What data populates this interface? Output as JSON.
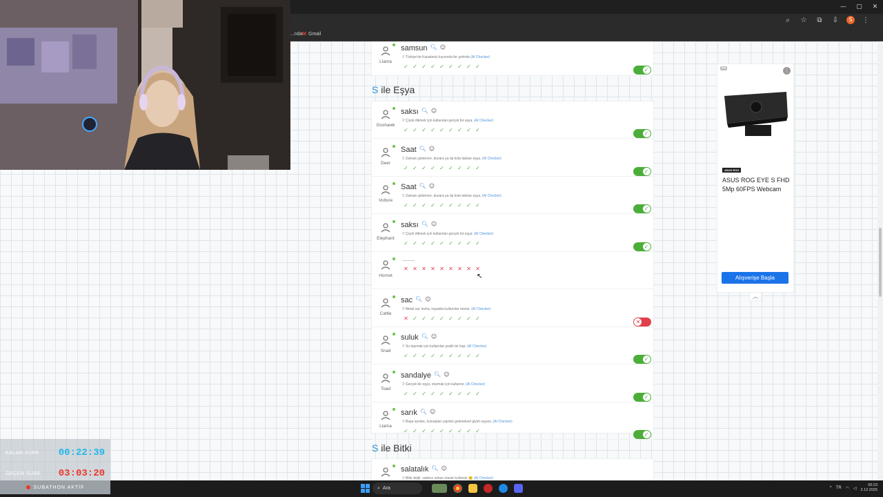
{
  "browser": {
    "bookmarks": [
      {
        "label": "...nda"
      },
      {
        "label": "Gmail"
      }
    ],
    "win_controls": [
      "—",
      "▢",
      "✕"
    ],
    "toolbar_icons": [
      "⌕",
      "☆",
      "⧉",
      "⇩"
    ],
    "profile_initial": "S"
  },
  "top_entry": {
    "word": "samsun",
    "desc": "Türkiye'de Karadeniz kıyısında bir şehirde",
    "ai": "(AI Checker)",
    "player": "Llama",
    "checks": [
      "ok",
      "ok",
      "ok",
      "ok",
      "ok",
      "ok",
      "ok",
      "ok",
      "ok"
    ],
    "toggle": "on"
  },
  "sections": [
    {
      "letter": "S",
      "title": "ile Eşya",
      "entries": [
        {
          "word": "saksı",
          "desc": "Çiçek dikmek için kullanılan gerçek bir eşya.",
          "ai": "(AI Checker)",
          "player": "Goshawk",
          "checks": [
            "ok",
            "ok",
            "ok",
            "ok",
            "ok",
            "ok",
            "ok",
            "ok",
            "ok"
          ],
          "toggle": "on"
        },
        {
          "word": "Saat",
          "desc": "Zamanı gösteren, duvara ya da kola takılan eşya.",
          "ai": "(AI Checker)",
          "player": "Deer",
          "checks": [
            "ok",
            "ok",
            "ok",
            "ok",
            "ok",
            "ok",
            "ok",
            "ok",
            "ok"
          ],
          "toggle": "on"
        },
        {
          "word": "Saat",
          "desc": "Zamanı gösteren, duvara ya da kola takılan eşya.",
          "ai": "(AI Checker)",
          "player": "Vulture",
          "checks": [
            "ok",
            "ok",
            "ok",
            "ok",
            "ok",
            "ok",
            "ok",
            "ok",
            "ok"
          ],
          "toggle": "on"
        },
        {
          "word": "saksı",
          "desc": "Çiçek dikmek için kullanılan gerçek bir eşya.",
          "ai": "(AI Checker)",
          "player": "Elephant",
          "checks": [
            "ok",
            "ok",
            "ok",
            "ok",
            "ok",
            "ok",
            "ok",
            "ok",
            "ok"
          ],
          "toggle": "on"
        },
        {
          "word": "",
          "desc": "",
          "ai": "",
          "player": "Hornet",
          "checks": [
            "no",
            "no",
            "no",
            "no",
            "no",
            "no",
            "no",
            "no",
            "no"
          ],
          "toggle": "none"
        },
        {
          "word": "sac",
          "desc": "Metal sac levha, inşaatta kullanılan nesne.",
          "ai": "(AI Checker)",
          "player": "Cattle",
          "checks": [
            "no",
            "ok",
            "ok",
            "ok",
            "ok",
            "ok",
            "ok",
            "ok",
            "ok"
          ],
          "toggle": "off"
        },
        {
          "word": "suluk",
          "desc": "Su taşımak için kullanılan pratik bir kap.",
          "ai": "(AI Checker)",
          "player": "Snail",
          "checks": [
            "ok",
            "ok",
            "ok",
            "ok",
            "ok",
            "ok",
            "ok",
            "ok",
            "ok"
          ],
          "toggle": "on"
        },
        {
          "word": "sandalye",
          "desc": "Gerçek bir eşya, oturmak için kullanılır.",
          "ai": "(AI Checker)",
          "player": "Toad",
          "checks": [
            "ok",
            "ok",
            "ok",
            "ok",
            "ok",
            "ok",
            "ok",
            "ok",
            "ok"
          ],
          "toggle": "on"
        },
        {
          "word": "sarık",
          "desc": "Başa sarılan, kumaştan yapılan geleneksel giyim eşyası.",
          "ai": "(AI Checker)",
          "player": "Llama",
          "checks": [
            "ok",
            "ok",
            "ok",
            "ok",
            "ok",
            "ok",
            "ok",
            "ok",
            "ok"
          ],
          "toggle": "on"
        }
      ]
    },
    {
      "letter": "S",
      "title": "ile Bitki",
      "entries": [
        {
          "word": "salatalık",
          "desc": "Bitki değil, sadece sebze olarak kullanılır 😊",
          "ai": "(AI Checker)",
          "player": "",
          "checks": [],
          "toggle": "none"
        }
      ]
    }
  ],
  "ad": {
    "tag": "Ad",
    "badge": "ASUS ROG",
    "title": "ASUS ROG EYE S FHD 5Mp 60FPS Webcam",
    "button": "Alışverişe Başla"
  },
  "overlay": {
    "remaining_label": "KALAN SÜRE",
    "remaining_value": "00:22:39",
    "past_label": "GEÇEN SÜRE",
    "past_value": "03:03:20",
    "status": "SUBATHON AKTİF"
  },
  "taskbar": {
    "search": "Ara",
    "tray": "TR",
    "clock_time": "00:23",
    "clock_date": "2.12.2025"
  },
  "colors": {
    "check_ok": "#4cae3a",
    "check_no": "#e0404a",
    "accent": "#2a8fd4",
    "ad_button": "#1a73e8"
  },
  "icons": {
    "search": "search-icon",
    "smile": "smile-icon",
    "check": "check-icon",
    "cross": "cross-icon"
  }
}
